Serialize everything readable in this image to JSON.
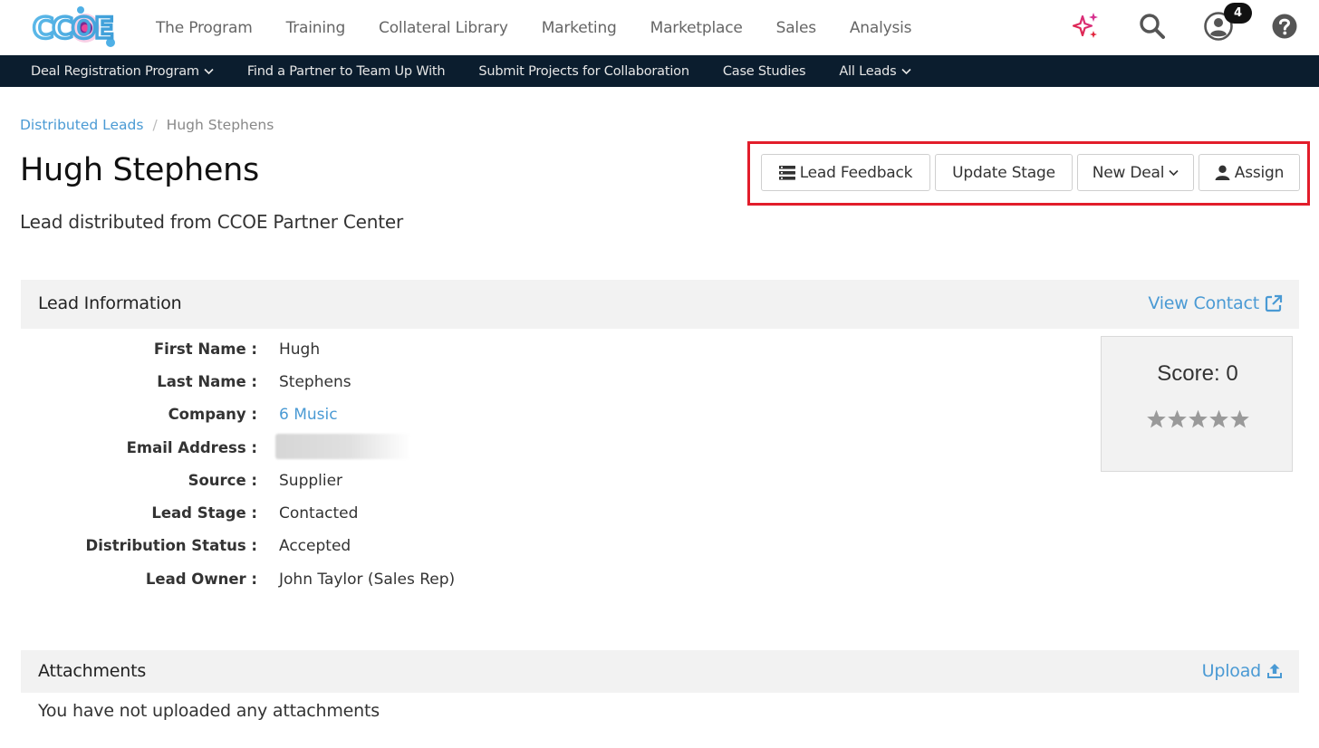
{
  "brand": {
    "logo_text": "CCOE"
  },
  "topnav": {
    "items": [
      "The Program",
      "Training",
      "Collateral Library",
      "Marketing",
      "Marketplace",
      "Sales",
      "Analysis"
    ],
    "notification_count": "4",
    "icons": [
      "sparkle-icon",
      "search-icon",
      "user-icon",
      "help-icon"
    ]
  },
  "subnav": {
    "items": [
      {
        "label": "Deal Registration Program",
        "dropdown": true
      },
      {
        "label": "Find a Partner to Team Up With",
        "dropdown": false
      },
      {
        "label": "Submit Projects for Collaboration",
        "dropdown": false
      },
      {
        "label": "Case Studies",
        "dropdown": false
      },
      {
        "label": "All Leads",
        "dropdown": true
      }
    ]
  },
  "breadcrumb": {
    "parent": "Distributed Leads",
    "separator": "/",
    "current": "Hugh Stephens"
  },
  "page": {
    "title": "Hugh Stephens",
    "subtitle": "Lead distributed from CCOE Partner Center"
  },
  "actions": {
    "lead_feedback": "Lead Feedback",
    "update_stage": "Update Stage",
    "new_deal": "New Deal",
    "assign": "Assign",
    "highlight_color": "#e21d2b"
  },
  "lead_info": {
    "heading": "Lead Information",
    "view_contact": "View Contact",
    "fields": [
      {
        "label": "First Name :",
        "value": "Hugh"
      },
      {
        "label": "Last Name :",
        "value": "Stephens"
      },
      {
        "label": "Company :",
        "value": "6 Music"
      },
      {
        "label": "Email Address :",
        "value": ""
      },
      {
        "label": "Source :",
        "value": "Supplier"
      },
      {
        "label": "Lead Stage :",
        "value": "Contacted"
      },
      {
        "label": "Distribution Status :",
        "value": "Accepted"
      },
      {
        "label": "Lead Owner :",
        "value": "John Taylor (Sales Rep)"
      }
    ],
    "score": "Score: 0",
    "stars_rating": 0,
    "stars_total": 5
  },
  "attachments": {
    "heading": "Attachments",
    "upload": "Upload",
    "empty_text": "You have not uploaded any attachments"
  },
  "colors": {
    "link": "#4a9ad4",
    "subnav_bg": "#0b1d2e",
    "panel_bg": "#f2f2f2"
  }
}
